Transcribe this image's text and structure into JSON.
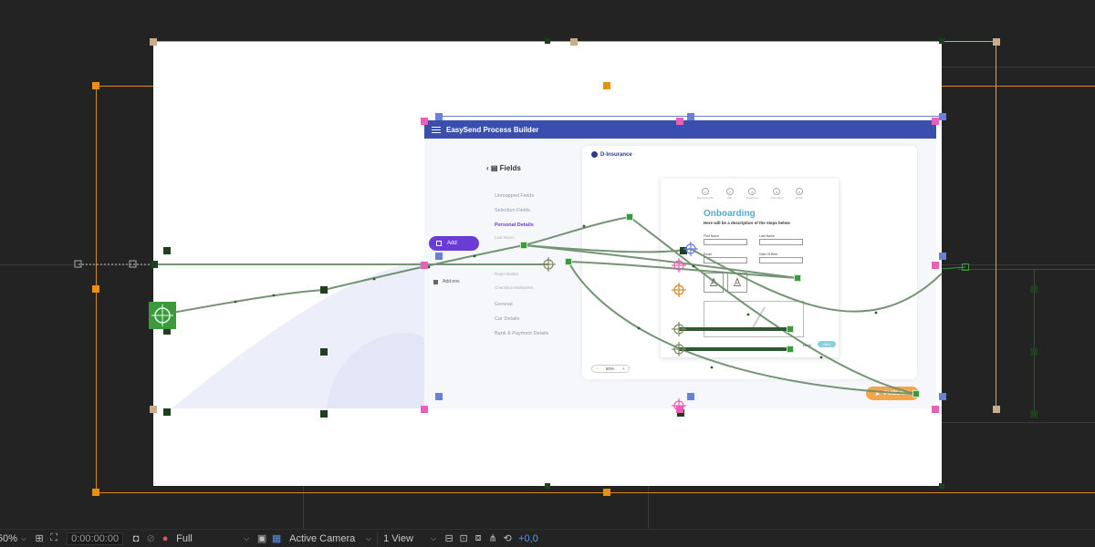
{
  "viewer": {
    "zoom": "50%",
    "timecode": "0:00:00:00",
    "resolution": "Full",
    "camera": "Active Camera",
    "views": "1 View",
    "exposure": "+0,0"
  },
  "icons": {
    "snapshot": "camera-icon",
    "show_snapshot": "snapshot-icon",
    "color_channels": "color-channel-icon",
    "grid": "grid-icon",
    "roi": "region-of-interest-icon",
    "transparency_grid": "transparency-grid-icon",
    "fast_preview": "fast-preview-icon",
    "timeline": "timeline-icon",
    "flowchart": "flowchart-icon",
    "reset_exposure": "reset-exposure-icon"
  },
  "app": {
    "title": "EasySend Process Builder",
    "add_label": "Add",
    "sidebar_item": "Add-ons",
    "fields_title": "Fields",
    "field_groups": [
      {
        "label": "Unmapped Fields",
        "active": false
      },
      {
        "label": "Selection Fields",
        "active": false
      },
      {
        "label": "Personal Details",
        "active": true
      },
      {
        "label": "General",
        "active": false
      },
      {
        "label": "Car Details",
        "active": false
      },
      {
        "label": "Bank & Payment Details",
        "active": false
      }
    ],
    "field_items": [
      "Last Name",
      "Radio Button",
      "Checkbox Multiselect"
    ],
    "company": "D-Insurance",
    "steps": [
      {
        "num": "1",
        "label": "Personal Info"
      },
      {
        "num": "2",
        "label": "Car"
      },
      {
        "num": "3",
        "label": "Insurance"
      },
      {
        "num": "4",
        "label": "Summary"
      },
      {
        "num": "5",
        "label": "Finish"
      }
    ],
    "form_title": "Onboarding",
    "form_desc": "Here will be a description of the steps below",
    "first_name": "First Name",
    "last_name": "Last Name",
    "email": "Email",
    "dob": "Date Of Birth",
    "signature_note": "Please sign here using your finger",
    "back": "Back",
    "next": "Next",
    "zoom_minus": "-",
    "zoom_value": "50%",
    "zoom_plus": "+",
    "publish": "PUBLISH"
  },
  "colors": {
    "header": "#3a4fad",
    "add_button": "#6b3bd6",
    "publish": "#f0a64a",
    "motion_path": "#4f8a4f",
    "frame": "#c8ad86",
    "anchor": "#e88f14",
    "blue_handle": "#6a7fd6",
    "pink_handle": "#ec5fb9"
  }
}
